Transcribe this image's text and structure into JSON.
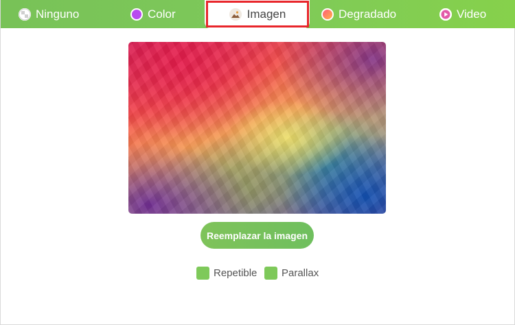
{
  "tabs": {
    "none": {
      "label": "Ninguno",
      "icon": "checker-circle-icon"
    },
    "color": {
      "label": "Color",
      "icon": "purple-dot-icon",
      "swatch": "#b84bf0"
    },
    "image": {
      "label": "Imagen",
      "icon": "image-icon",
      "active": true
    },
    "gradient": {
      "label": "Degradado",
      "icon": "gradient-dot-icon"
    },
    "video": {
      "label": "Video",
      "icon": "play-circle-icon"
    }
  },
  "main": {
    "replace_button": "Reemplazar la imagen",
    "options": [
      {
        "label": "Repetible",
        "checked": true
      },
      {
        "label": "Parallax",
        "checked": true
      }
    ]
  },
  "colors": {
    "accent_green": "#7ec95a",
    "highlight_red": "#e8262b",
    "color_swatch": "#b84bf0"
  }
}
